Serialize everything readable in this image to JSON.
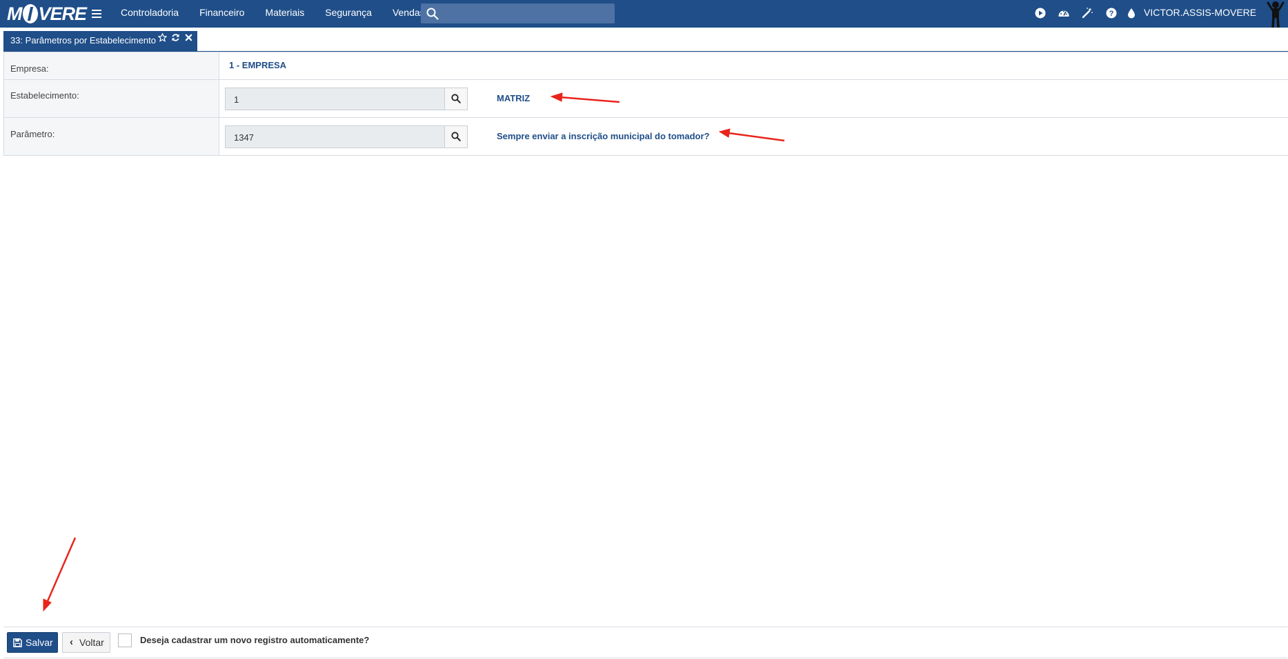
{
  "topbar": {
    "logo": "MOVERE",
    "menu": [
      "Controladoria",
      "Financeiro",
      "Materiais",
      "Segurança",
      "Vendas"
    ],
    "search_placeholder": "",
    "user": "VICTOR.ASSIS-MOVERE",
    "icons": [
      "play-icon",
      "dashboard-icon",
      "magic-wand-icon",
      "help-icon",
      "drop-icon",
      "user-figure-icon"
    ],
    "bar_color": "#1f4e89"
  },
  "tab": {
    "title": "33: Parâmetros por Estabelecimento",
    "icons": [
      "star-icon",
      "refresh-icon",
      "close-icon"
    ]
  },
  "form": {
    "empresa_label": "Empresa:",
    "empresa_value": "1 - EMPRESA",
    "estabelecimento_label": "Estabelecimento:",
    "estabelecimento_input": "1",
    "estabelecimento_desc": "MATRIZ",
    "parametro_label": "Parâmetro:",
    "parametro_input": "1347",
    "parametro_desc": "Sempre enviar a inscrição municipal do tomador?"
  },
  "footer": {
    "save_label": "Salvar",
    "back_label": "Voltar",
    "auto_checkbox_checked": false,
    "auto_checkbox_label": "Deseja cadastrar um novo registro automaticamente?"
  },
  "annotation_color": "#e8241c"
}
